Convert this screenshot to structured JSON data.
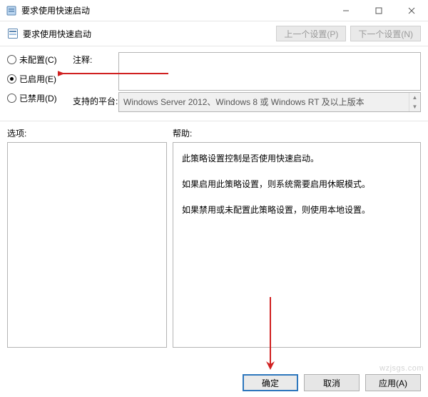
{
  "window": {
    "title": "要求使用快速启动"
  },
  "header": {
    "policy_title": "要求使用快速启动",
    "prev_setting": "上一个设置(P)",
    "next_setting": "下一个设置(N)"
  },
  "radios": {
    "not_configured": "未配置(C)",
    "enabled": "已启用(E)",
    "disabled": "已禁用(D)",
    "selected": "enabled"
  },
  "labels": {
    "comment": "注释:",
    "supported_on": "支持的平台:",
    "options": "选项:",
    "help": "帮助:"
  },
  "fields": {
    "comment_value": "",
    "supported_on_value": "Windows Server 2012、Windows 8 或 Windows RT 及以上版本"
  },
  "help_text": {
    "p1": "此策略设置控制是否使用快速启动。",
    "p2": "如果启用此策略设置，则系统需要启用休眠模式。",
    "p3": "如果禁用或未配置此策略设置，则使用本地设置。"
  },
  "buttons": {
    "ok": "确定",
    "cancel": "取消",
    "apply": "应用(A)"
  },
  "watermark": "wzjsgs.com"
}
